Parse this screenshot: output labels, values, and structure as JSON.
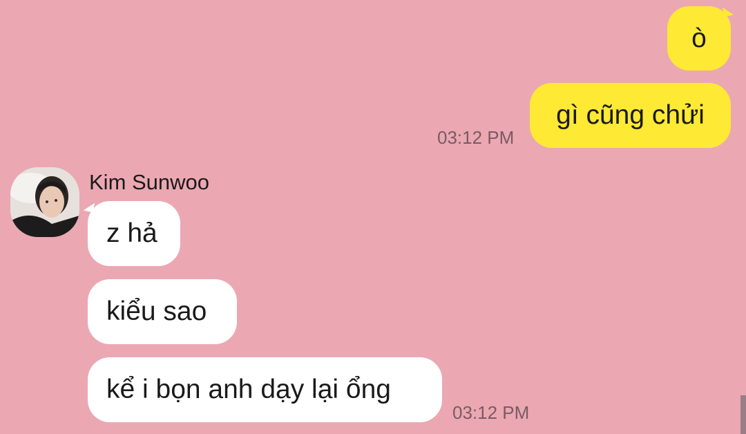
{
  "chat": {
    "outgoing": [
      {
        "text": "ò"
      },
      {
        "text": "gì cũng chửi",
        "time": "03:12 PM"
      }
    ],
    "contact": {
      "name": "Kim Sunwoo",
      "avatar_icon": "profile-photo"
    },
    "incoming": [
      {
        "text": "z hả"
      },
      {
        "text": "kiểu sao"
      },
      {
        "text": "kể i bọn anh dạy lại ổng",
        "time": "03:12 PM"
      }
    ]
  },
  "colors": {
    "background": "#eba8b2",
    "outgoing_bubble": "#fee934",
    "incoming_bubble": "#ffffff",
    "timestamp": "#7a5a63"
  }
}
